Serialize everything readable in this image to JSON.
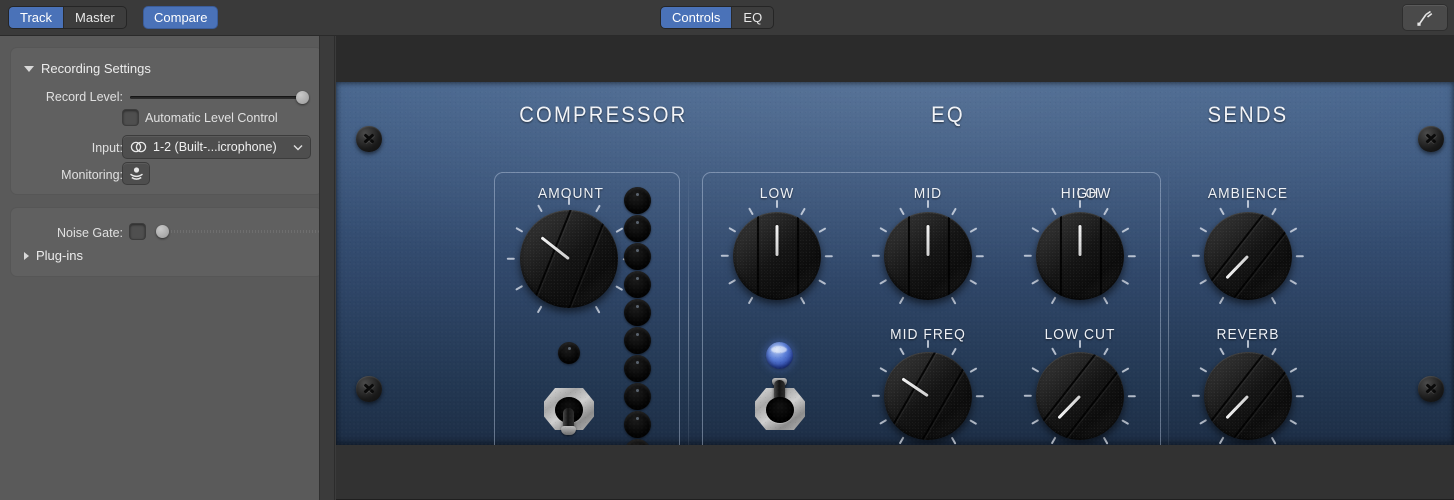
{
  "topbar": {
    "left_segments": [
      {
        "label": "Track",
        "selected": true
      },
      {
        "label": "Master",
        "selected": false
      }
    ],
    "compare_label": "Compare",
    "view_segments": [
      {
        "label": "Controls",
        "selected": true
      },
      {
        "label": "EQ",
        "selected": false
      }
    ],
    "tuner_icon": "tuning-fork-icon"
  },
  "sidebar": {
    "recording_settings": {
      "title": "Recording Settings",
      "expanded": true,
      "record_level_label": "Record Level:",
      "record_level_value": "100",
      "automatic_level_control_label": "Automatic Level Control",
      "automatic_level_control_checked": false,
      "input_label": "Input:",
      "input_value": "1-2  (Built-...icrophone)",
      "input_icon": "stereo-input-icon",
      "monitoring_label": "Monitoring:",
      "monitoring_icon": "monitoring-speaker-icon"
    },
    "noise_gate": {
      "label": "Noise Gate:",
      "checked": false,
      "value": "0"
    },
    "plugins": {
      "label": "Plug-ins",
      "expanded": false
    }
  },
  "amp": {
    "sections": [
      {
        "title": "COMPRESSOR",
        "controls": [
          {
            "name": "AMOUNT",
            "type": "knob",
            "angle": -52
          }
        ],
        "led_label": "compressor-indicator-led",
        "toggle_label": "compressor-power-toggle",
        "toggle_state": "down",
        "meter_led_count": 10
      },
      {
        "title": "EQ",
        "controls": [
          {
            "name": "LOW",
            "type": "knob",
            "angle": 0
          },
          {
            "name": "MID",
            "type": "knob",
            "angle": 0
          },
          {
            "name": "HIGH",
            "type": "knob",
            "angle": 0
          },
          {
            "name": "MID FREQ",
            "type": "knob",
            "angle": -56
          },
          {
            "name": "LOW CUT",
            "type": "knob",
            "angle": -136
          }
        ],
        "led_label": "eq-indicator-led",
        "led_state": "on",
        "toggle_label": "eq-power-toggle",
        "toggle_state": "up"
      },
      {
        "title": "SENDS",
        "controls": [
          {
            "name": "AMBIENCE",
            "type": "knob",
            "angle": -136
          },
          {
            "name": "REVERB",
            "type": "knob",
            "angle": -136
          }
        ]
      }
    ]
  },
  "colors": {
    "accent_blue": "#4a72b8",
    "panel_blue_top": "#44638c",
    "panel_blue_bottom": "#1d2e46",
    "led_blue": "#5c7fd8",
    "sidebar_gray": "#5a5a5a"
  }
}
